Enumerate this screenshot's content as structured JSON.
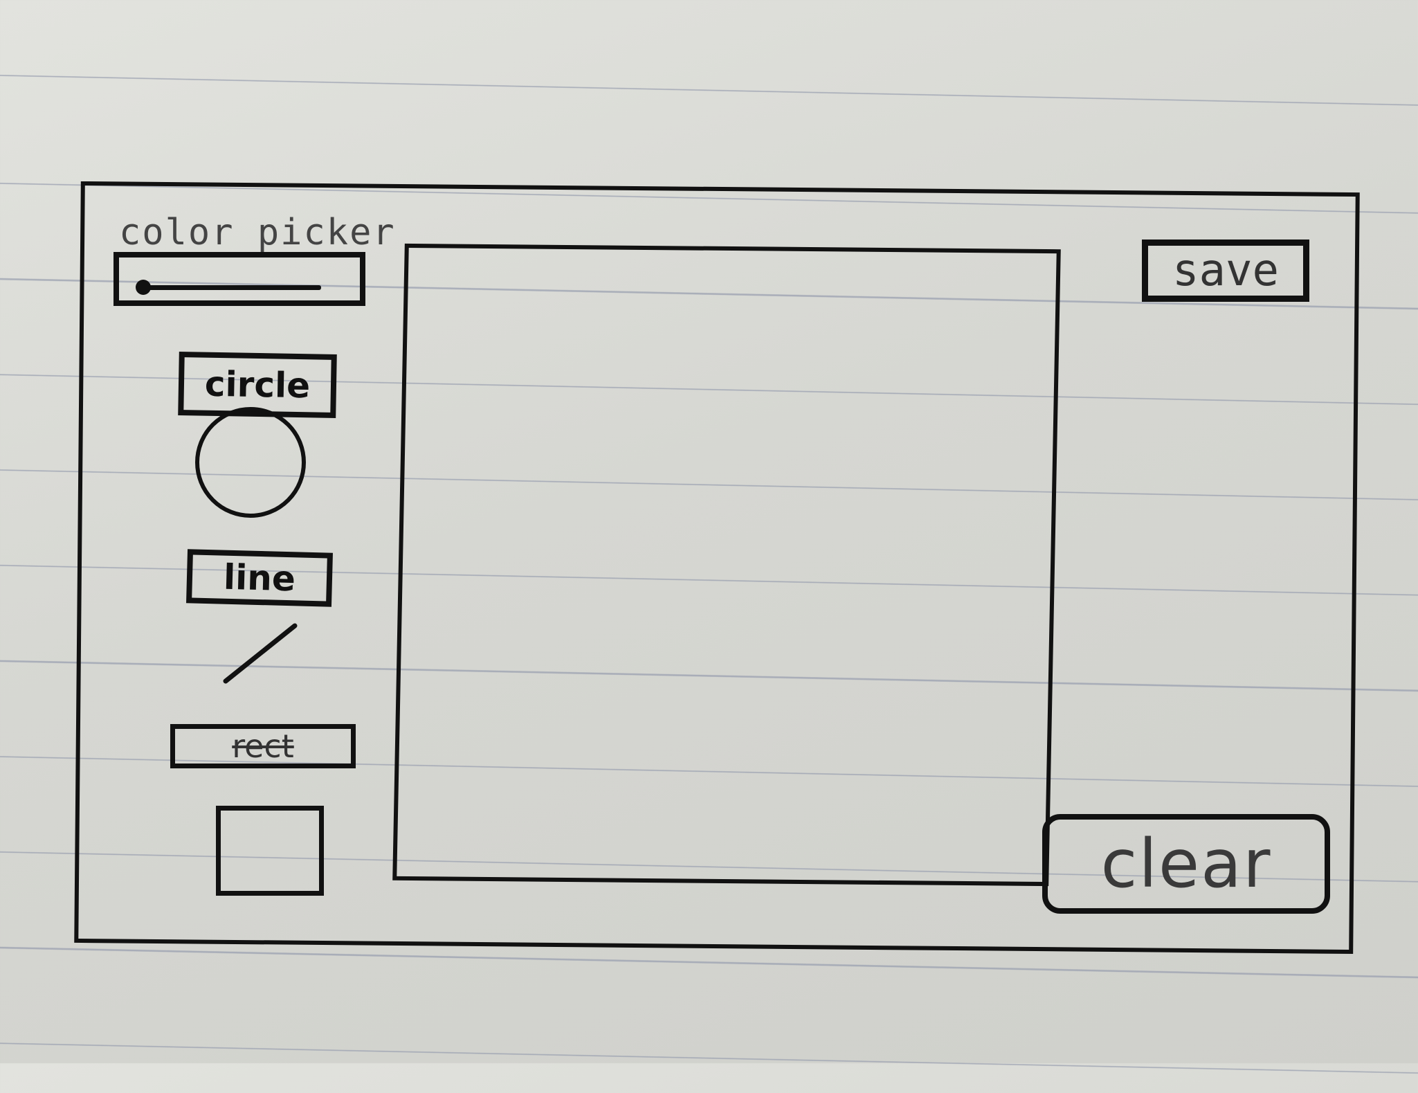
{
  "toolbar": {
    "color_picker_label": "color picker",
    "shapes": {
      "circle_label": "circle",
      "line_label": "line",
      "rect_label": "rect"
    }
  },
  "actions": {
    "save_label": "save",
    "clear_label": "clear"
  },
  "colors": {
    "ink": "#111111",
    "paper": "#d8d9d4",
    "rule_lines": "#9aa0b0"
  }
}
